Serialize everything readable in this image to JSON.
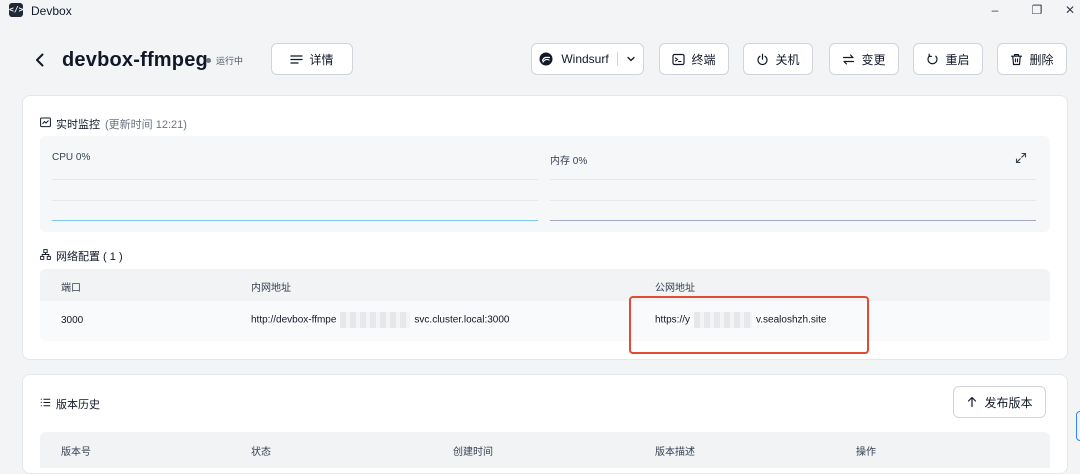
{
  "window": {
    "title": "Devbox",
    "logo_glyph": "</>",
    "minimize": "–",
    "maximize": "❐",
    "close": "✕"
  },
  "header": {
    "name": "devbox-ffmpeg",
    "status": "运行中",
    "detail_label": "详情",
    "ide_label": "Windsurf",
    "terminal_label": "终端",
    "shutdown_label": "关机",
    "change_label": "变更",
    "restart_label": "重启",
    "delete_label": "删除"
  },
  "monitor": {
    "title": "实时监控",
    "updated": "(更新时间 12:21)",
    "cpu_label": "CPU 0%",
    "mem_label": "内存 0%"
  },
  "network": {
    "title": "网络配置 ( 1 )",
    "columns": [
      "端口",
      "内网地址",
      "公网地址"
    ],
    "rows": [
      {
        "port": "3000",
        "internal_prefix": "http://devbox-ffmpe",
        "internal_suffix": "svc.cluster.local:3000",
        "public_prefix": "https://y",
        "public_suffix": "v.sealoshzh.site"
      }
    ]
  },
  "versions": {
    "title": "版本历史",
    "publish_label": "发布版本",
    "columns": [
      "版本号",
      "状态",
      "创建时间",
      "版本描述",
      "操作"
    ]
  },
  "colors": {
    "cpu_line": "#7cc8f0",
    "mem_line": "#a3a6c4",
    "highlight": "#e24a33"
  }
}
